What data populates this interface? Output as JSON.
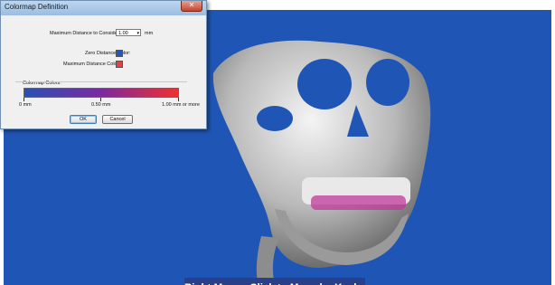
{
  "dialog": {
    "title": "Colormap Definition",
    "close_glyph": "✕",
    "max_distance_label": "Maximum Distance to Consider:",
    "max_distance_value": "1.00",
    "max_distance_unit": "mm",
    "zero_color_label": "Zero Distance Color:",
    "max_color_label": "Maximum Distance Color:",
    "colormap_label": "Colormap Colors:",
    "tick_labels": [
      "0 mm",
      "0.50 mm",
      "1.00 mm or more"
    ],
    "ok_label": "OK",
    "cancel_label": "Cancel",
    "colors": {
      "zero": "#2757b5",
      "max": "#e0404a",
      "gradient_start": "#2a50b0",
      "gradient_end": "#f03030"
    }
  },
  "viewport": {
    "status_text": "Right Mouse Click to Move by Keyboard",
    "background": "#1f55b4"
  }
}
